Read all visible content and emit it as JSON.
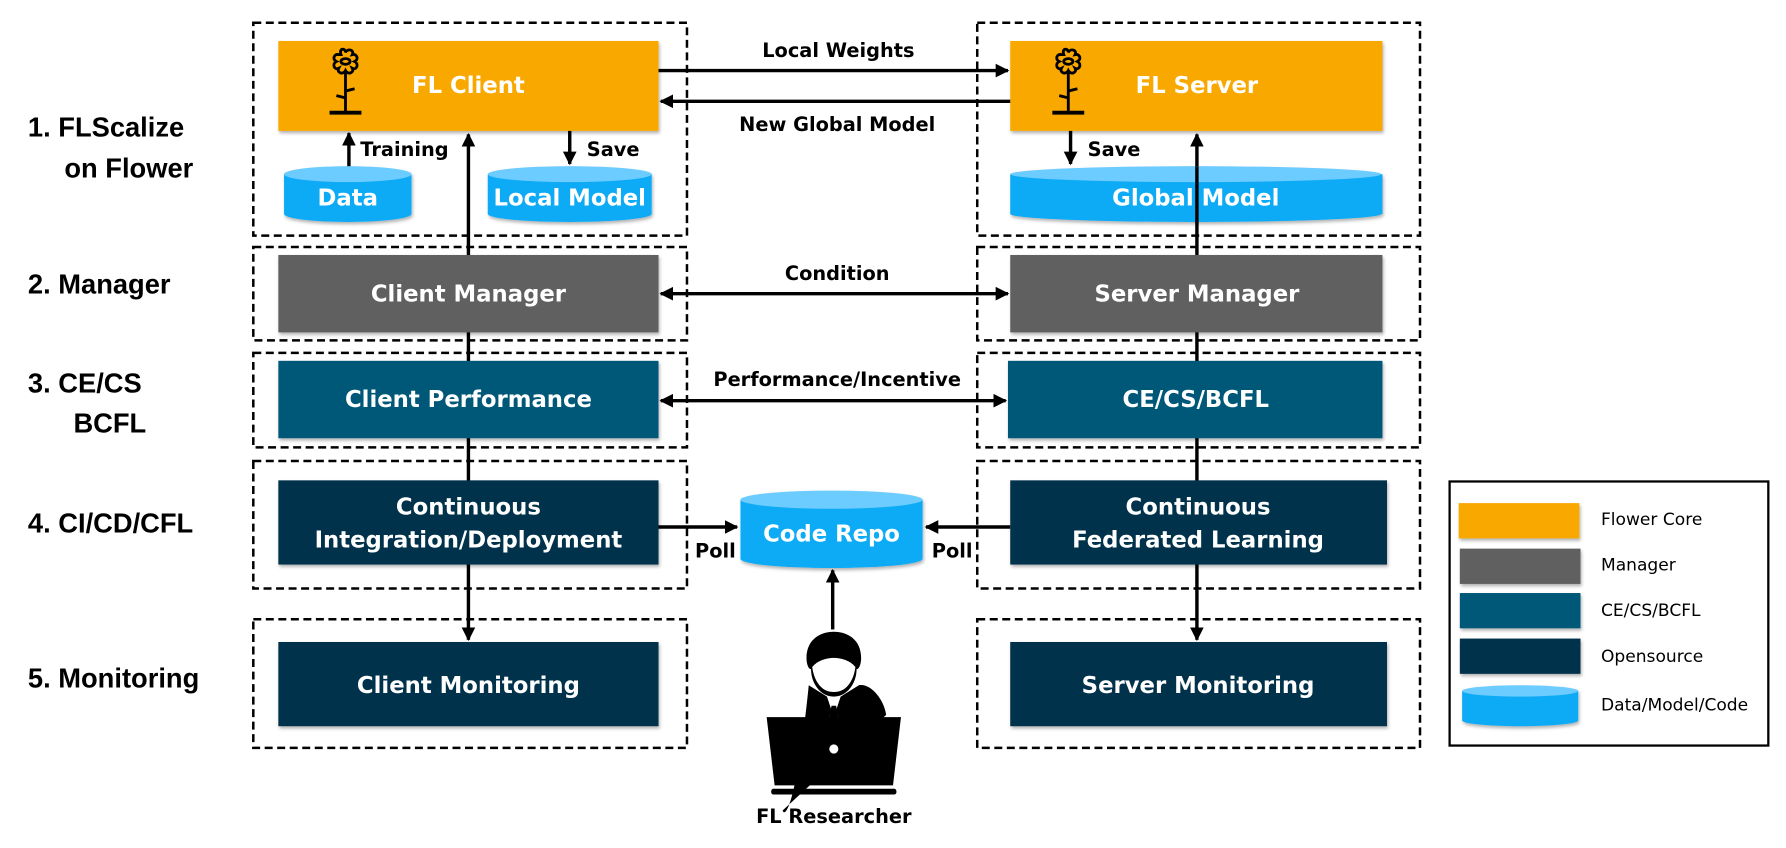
{
  "colors": {
    "flower_core": "#F9A800",
    "manager": "#606060",
    "ce_cs_bcfl": "#005878",
    "opensource": "#00304C",
    "data_model_code": "#0DAAF6",
    "cylinder_top": "#6CCBFF"
  },
  "layers": [
    {
      "lines": [
        "1. FLScalize",
        "on Flower"
      ]
    },
    {
      "lines": [
        "2. Manager"
      ]
    },
    {
      "lines": [
        "3. CE/CS",
        "BCFL"
      ]
    },
    {
      "lines": [
        "4. CI/CD/CFL"
      ]
    },
    {
      "lines": [
        "5. Monitoring"
      ]
    }
  ],
  "client": {
    "fl_client": "FL Client",
    "data": "Data",
    "local_model": "Local Model",
    "training": "Training",
    "save": "Save",
    "manager": "Client Manager",
    "performance": "Client Performance",
    "ci_cd": [
      "Continuous",
      "Integration/Deployment"
    ],
    "monitoring": "Client Monitoring"
  },
  "server": {
    "fl_server": "FL Server",
    "global_model": "Global Model",
    "save": "Save",
    "manager": "Server Manager",
    "ce_cs_bcfl": "CE/CS/BCFL",
    "cfl": [
      "Continuous",
      "Federated Learning"
    ],
    "monitoring": "Server Monitoring"
  },
  "flows": {
    "local_weights": "Local Weights",
    "new_global_model": "New Global Model",
    "condition": "Condition",
    "performance_incentive": "Performance/Incentive",
    "poll_left": "Poll",
    "poll_right": "Poll"
  },
  "code_repo": "Code Repo",
  "researcher": "FL Researcher",
  "icons": {
    "flower": "flower-icon",
    "researcher": "person-laptop-icon"
  },
  "legend": [
    {
      "label": "Flower Core",
      "swatch": "box"
    },
    {
      "label": "Manager",
      "swatch": "box"
    },
    {
      "label": "CE/CS/BCFL",
      "swatch": "box"
    },
    {
      "label": "Opensource",
      "swatch": "box"
    },
    {
      "label": "Data/Model/Code",
      "swatch": "cylinder"
    }
  ]
}
